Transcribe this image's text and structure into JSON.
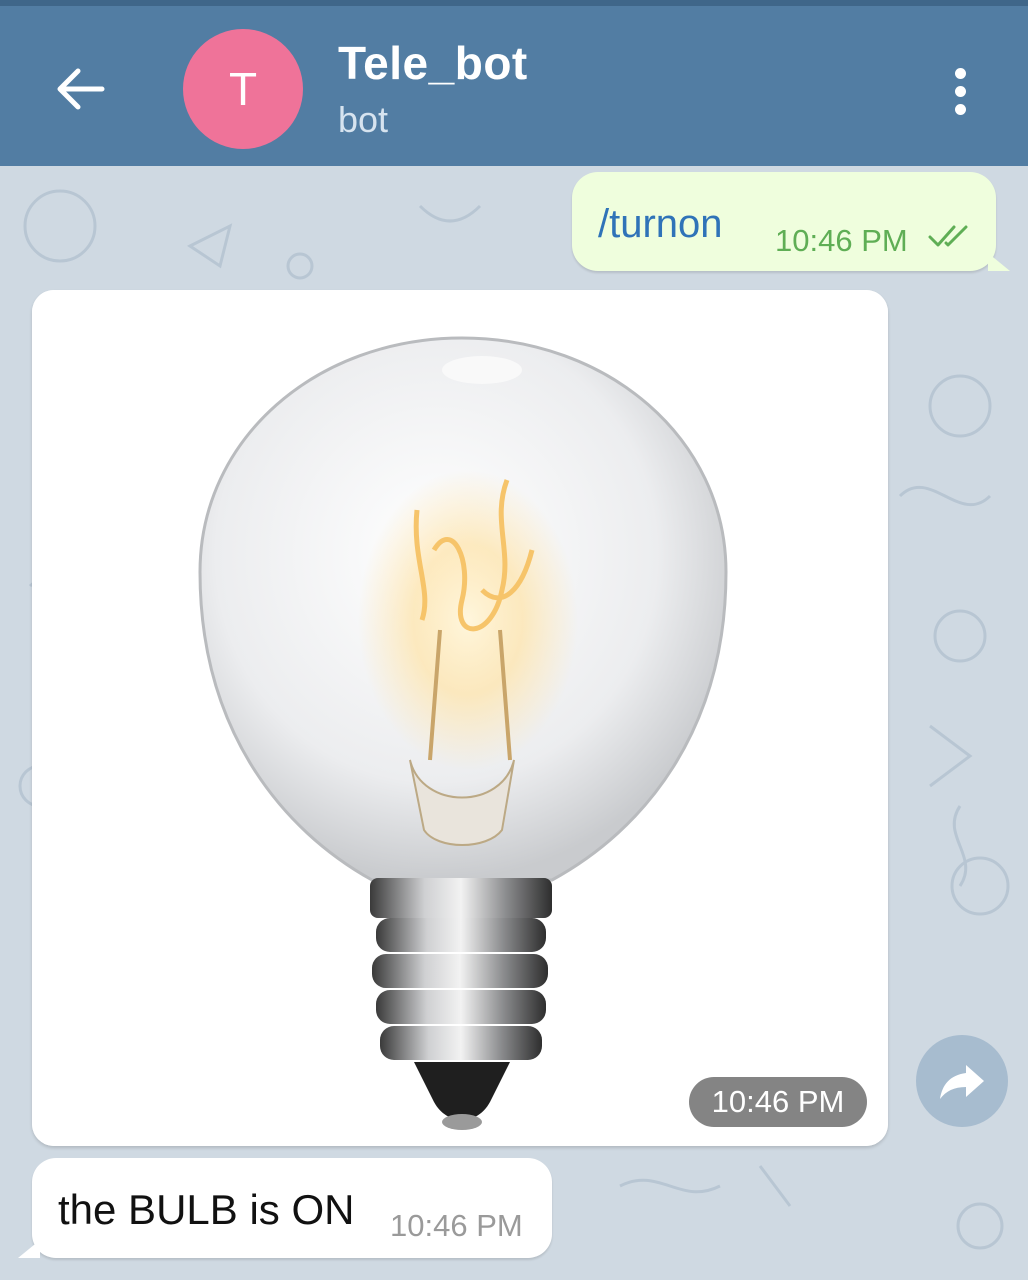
{
  "header": {
    "back_icon": "arrow-left-icon",
    "avatar_letter": "T",
    "avatar_color": "#ef7399",
    "title": "Tele_bot",
    "subtitle": "bot",
    "menu_icon": "more-vertical-icon",
    "bar_color": "#527da3"
  },
  "messages": {
    "outgoing": {
      "text": "/turnon",
      "time": "10:46 PM",
      "status_icon": "double-check-icon"
    },
    "photo": {
      "image": "light-bulb-photo",
      "time": "10:46 PM",
      "share_icon": "share-arrow-icon"
    },
    "incoming": {
      "text": "the BULB is ON",
      "time": "10:46 PM"
    }
  }
}
